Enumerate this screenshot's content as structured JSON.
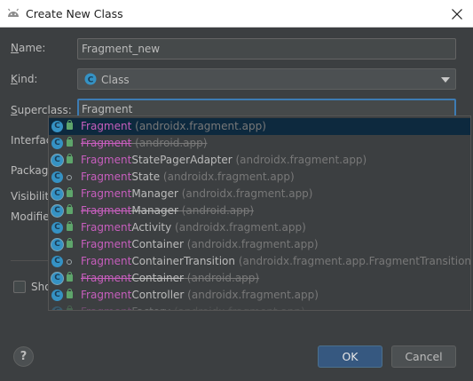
{
  "window": {
    "title": "Create New Class"
  },
  "form": {
    "name_label_u": "N",
    "name_label_rest": "ame:",
    "name_value": "Fragment_new",
    "kind_label_u": "K",
    "kind_label_rest": "ind:",
    "kind_value": "Class",
    "superclass_label_u": "S",
    "superclass_label_rest": "uperclass:",
    "superclass_value": "Fragment",
    "interfaces_label": "Interfac",
    "package_label": "Package",
    "visibility_label": "Visibility",
    "modifiers_label": "Modifie",
    "show_checkbox_label": "Sho"
  },
  "autocomplete": {
    "items": [
      {
        "match": "Fragment",
        "rest": "",
        "pkg": " (androidx.fragment.app)",
        "icon": "class-icon",
        "icon_glyph": "C",
        "visibility": "public",
        "deprecated": false,
        "selected": true
      },
      {
        "match": "Fragment",
        "rest": "",
        "pkg": " (android.app)",
        "icon": "class-icon",
        "icon_glyph": "C",
        "visibility": "public",
        "deprecated": true,
        "selected": false
      },
      {
        "match": "Fragment",
        "rest": "StatePagerAdapter",
        "pkg": " (androidx.fragment.app)",
        "icon": "abstract-class-icon",
        "icon_glyph": "C",
        "visibility": "public",
        "deprecated": false,
        "selected": false
      },
      {
        "match": "Fragment",
        "rest": "State",
        "pkg": " (androidx.fragment.app)",
        "icon": "class-icon",
        "icon_glyph": "C",
        "visibility": "package",
        "deprecated": false,
        "selected": false
      },
      {
        "match": "Fragment",
        "rest": "Manager",
        "pkg": " (androidx.fragment.app)",
        "icon": "abstract-class-icon",
        "icon_glyph": "C",
        "visibility": "public",
        "deprecated": false,
        "selected": false
      },
      {
        "match": "Fragment",
        "rest": "Manager",
        "pkg": " (android.app)",
        "icon": "abstract-class-icon",
        "icon_glyph": "C",
        "visibility": "public",
        "deprecated": true,
        "selected": false
      },
      {
        "match": "Fragment",
        "rest": "Activity",
        "pkg": " (androidx.fragment.app)",
        "icon": "class-icon",
        "icon_glyph": "C",
        "visibility": "public",
        "deprecated": false,
        "selected": false
      },
      {
        "match": "Fragment",
        "rest": "Container",
        "pkg": " (androidx.fragment.app)",
        "icon": "abstract-class-icon",
        "icon_glyph": "C",
        "visibility": "public",
        "deprecated": false,
        "selected": false
      },
      {
        "match": "Fragment",
        "rest": "ContainerTransition",
        "pkg": " (androidx.fragment.app.FragmentTransition)",
        "icon": "class-icon",
        "icon_glyph": "C",
        "visibility": "package",
        "deprecated": false,
        "selected": false
      },
      {
        "match": "Fragment",
        "rest": "Container",
        "pkg": " (android.app)",
        "icon": "abstract-class-icon",
        "icon_glyph": "C",
        "visibility": "public",
        "deprecated": true,
        "selected": false
      },
      {
        "match": "Fragment",
        "rest": "Controller",
        "pkg": " (androidx.fragment.app)",
        "icon": "class-icon",
        "icon_glyph": "C",
        "visibility": "public",
        "deprecated": false,
        "selected": false
      },
      {
        "match": "Fragment",
        "rest": "Factory",
        "pkg": " (androidx.fragment.app)",
        "icon": "class-icon",
        "icon_glyph": "C",
        "visibility": "public",
        "deprecated": false,
        "selected": false,
        "partial": true
      }
    ]
  },
  "buttons": {
    "help_label": "?",
    "ok_label": "OK",
    "cancel_label": "Cancel"
  },
  "colors": {
    "match_highlight": "#c75ebd",
    "background": "#3c3f41",
    "selection": "#0d293e",
    "accent": "#3d7cb4"
  }
}
